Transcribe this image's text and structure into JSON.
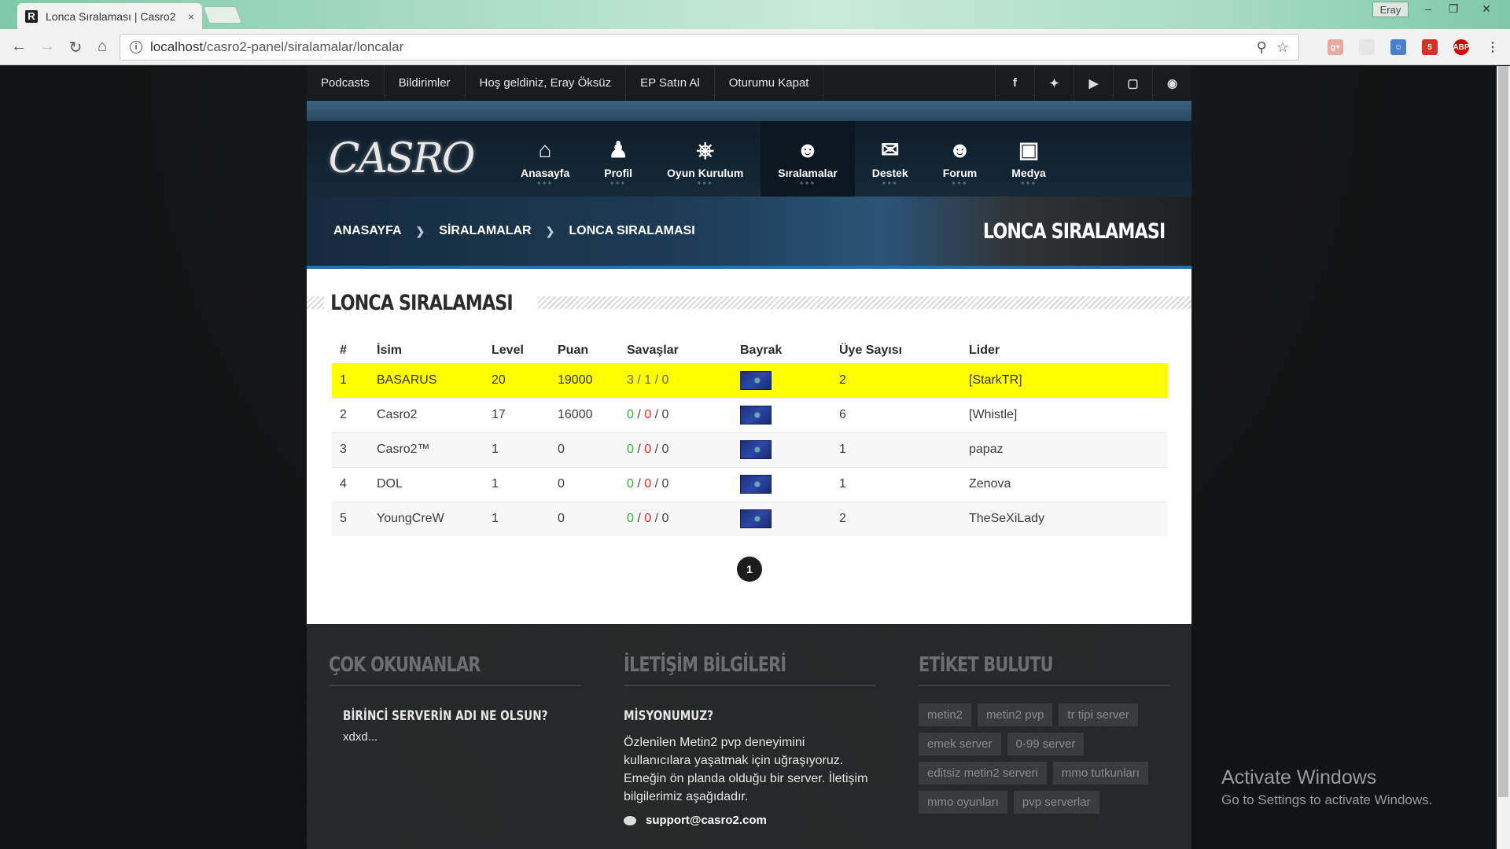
{
  "browser": {
    "tab_title": "Lonca Sıralaması | Casro2",
    "tab_close": "×",
    "favicon_letter": "R",
    "profile_name": "Eray",
    "url_host": "localhost",
    "url_path": "/casro2-panel/siralamalar/loncalar",
    "gmail_count": "5"
  },
  "topnav": {
    "links": [
      "Podcasts",
      "Bildirimler",
      "Hoş geldiniz, Eray Öksüz",
      "EP Satın Al",
      "Oturumu Kapat"
    ],
    "social_icons": [
      "facebook-icon",
      "twitter-icon",
      "youtube-icon",
      "twitch-icon",
      "steam-icon"
    ]
  },
  "logo": {
    "text": "CASRO"
  },
  "menu": [
    {
      "label": "Anasayfa",
      "icon": "home-icon"
    },
    {
      "label": "Profil",
      "icon": "user-icon"
    },
    {
      "label": "Oyun Kurulum",
      "icon": "gamepad-icon"
    },
    {
      "label": "Sıralamalar",
      "icon": "users-icon",
      "active": true
    },
    {
      "label": "Destek",
      "icon": "chat-icon"
    },
    {
      "label": "Forum",
      "icon": "users-icon"
    },
    {
      "label": "Medya",
      "icon": "camera-icon"
    }
  ],
  "breadcrumb": {
    "items": [
      "ANASAYFA",
      "SİRALAMALAR",
      "LONCA SIRALAMASI"
    ],
    "page_title": "LONCA SIRALAMASI"
  },
  "section": {
    "title": "LONCA SIRALAMASI"
  },
  "table": {
    "headers": [
      "#",
      "İsim",
      "Level",
      "Puan",
      "Savaşlar",
      "Bayrak",
      "Üye Sayısı",
      "Lider"
    ],
    "rows": [
      {
        "rank": "1",
        "name": "BASARUS",
        "level": "20",
        "points": "19000",
        "wins": "3",
        "losses": "1",
        "draws": "0",
        "members": "2",
        "leader": "[StarkTR]",
        "highlight": true
      },
      {
        "rank": "2",
        "name": "Casro2",
        "level": "17",
        "points": "16000",
        "wins": "0",
        "losses": "0",
        "draws": "0",
        "members": "6",
        "leader": "[Whistle]"
      },
      {
        "rank": "3",
        "name": "Casro2™",
        "level": "1",
        "points": "0",
        "wins": "0",
        "losses": "0",
        "draws": "0",
        "members": "1",
        "leader": "papaz"
      },
      {
        "rank": "4",
        "name": "DOL",
        "level": "1",
        "points": "0",
        "wins": "0",
        "losses": "0",
        "draws": "0",
        "members": "1",
        "leader": "Zenova"
      },
      {
        "rank": "5",
        "name": "YoungCreW",
        "level": "1",
        "points": "0",
        "wins": "0",
        "losses": "0",
        "draws": "0",
        "members": "2",
        "leader": "TheSeXiLady"
      }
    ],
    "war_separator": " / "
  },
  "pager": {
    "current": "1"
  },
  "footer": {
    "popular": {
      "title": "ÇOK OKUNANLAR",
      "post_title": "BİRİNCİ SERVERİN ADI NE OLSUN?",
      "post_excerpt": "xdxd..."
    },
    "contact": {
      "title": "İLETİŞİM BİLGİLERİ",
      "mission_title": "MİSYONUMUZ?",
      "mission_text": "Özlenilen Metin2 pvp deneyimini kullanıcılara yaşatmak için uğraşıyoruz. Emeğin ön planda olduğu bir server. İletişim bilgilerimiz aşağıdadır.",
      "email": "support@casro2.com"
    },
    "tags": {
      "title": "ETİKET BULUTU",
      "items": [
        "metin2",
        "metin2 pvp",
        "tr tipi server",
        "emek server",
        "0-99 server",
        "editsiz metin2 serveri",
        "mmo tutkunları",
        "mmo oyunları",
        "pvp serverlar"
      ]
    }
  },
  "windows_watermark": {
    "line1": "Activate Windows",
    "line2": "Go to Settings to activate Windows."
  }
}
